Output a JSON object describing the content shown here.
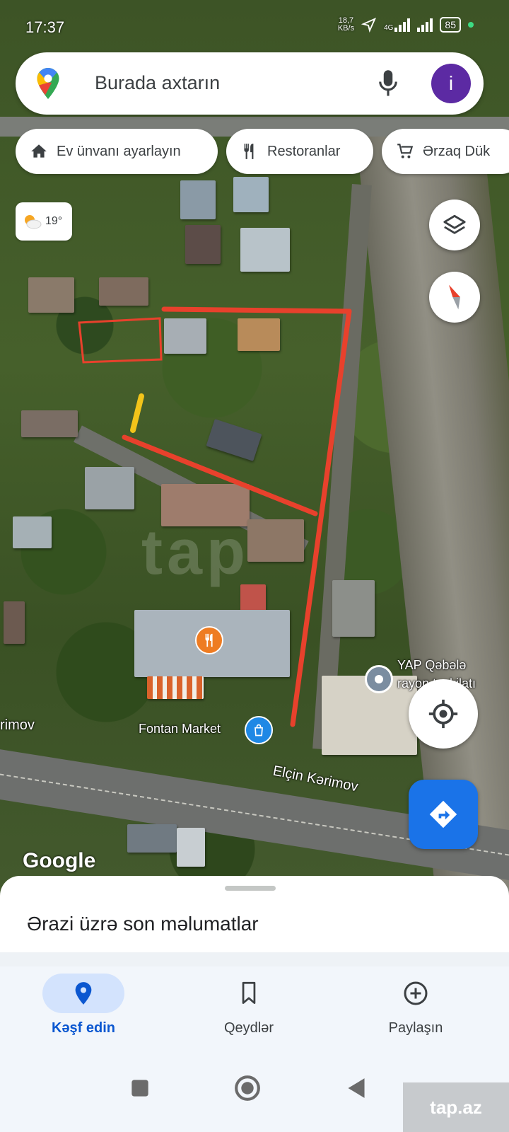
{
  "status_bar": {
    "time": "17:37",
    "net_speed": "18,7",
    "net_unit": "KB/s",
    "network_type": "4G",
    "battery": "85"
  },
  "search": {
    "placeholder": "Burada axtarın",
    "avatar_letter": "i"
  },
  "chips": [
    {
      "label": "Ev ünvanı ayarlayın",
      "icon": "home-icon"
    },
    {
      "label": "Restoranlar",
      "icon": "restaurant-icon"
    },
    {
      "label": "Ərzaq Dük",
      "icon": "cart-icon"
    }
  ],
  "weather": {
    "temp": "19°"
  },
  "map": {
    "places": [
      {
        "name": "YAP Qəbələ",
        "name_line2": "rayon təşkilatı"
      },
      {
        "name": "Fontan Market"
      }
    ],
    "street_left": "rimov",
    "street": "Elçin Kərimov",
    "watermark": "tap",
    "attribution": "Google"
  },
  "sheet": {
    "title": "Ərazi üzrə son məlumatlar"
  },
  "nav": [
    {
      "label": "Kəşf edin",
      "icon": "location-pin-icon",
      "active": true
    },
    {
      "label": "Qeydlər",
      "icon": "bookmark-icon",
      "active": false
    },
    {
      "label": "Paylaşın",
      "icon": "add-circle-icon",
      "active": false
    }
  ],
  "brand_watermark": "tap.az",
  "colors": {
    "accent": "#1a73e8",
    "avatar": "#5c2aa3",
    "boundary": "#e8412c",
    "marker": "#f2c41a"
  }
}
